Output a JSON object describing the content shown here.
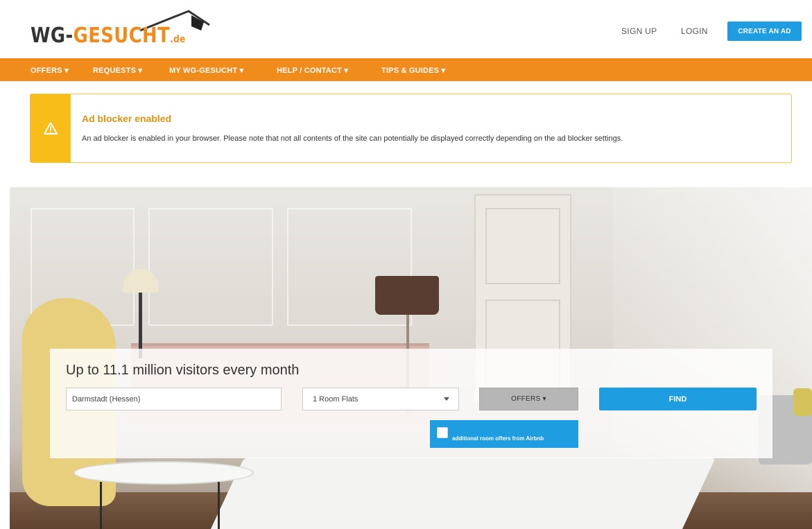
{
  "header": {
    "logo": {
      "wg": "WG-",
      "gesucht": "GESUCHT",
      "de": ".de"
    },
    "sign_up": "SIGN UP",
    "login": "LOGIN",
    "create_ad": "CREATE AN AD"
  },
  "nav": {
    "items": [
      {
        "label": "OFFERS ▾"
      },
      {
        "label": "REQUESTS ▾"
      },
      {
        "label": "MY WG-GESUCHT ▾"
      },
      {
        "label": "HELP / CONTACT ▾"
      },
      {
        "label": "TIPS & GUIDES ▾"
      }
    ]
  },
  "alert": {
    "icon": "warning-icon",
    "title": "Ad blocker enabled",
    "text": "An ad blocker is enabled in your browser. Please note that not all contents of the site can potentially be displayed correctly depending on the ad blocker settings."
  },
  "search": {
    "title": "Up to 11.1 million visitors every month",
    "city_value": "Darmstadt (Hessen)",
    "type_value": "1 Room Flats",
    "offers_label": "OFFERS ▾",
    "find_label": "FIND",
    "airbnb_label": "additional room offers from Airbnb",
    "airbnb_checked": false
  },
  "colors": {
    "brand_orange": "#f08c1c",
    "action_blue": "#1e9de0",
    "warning_yellow": "#f9bd1a"
  }
}
